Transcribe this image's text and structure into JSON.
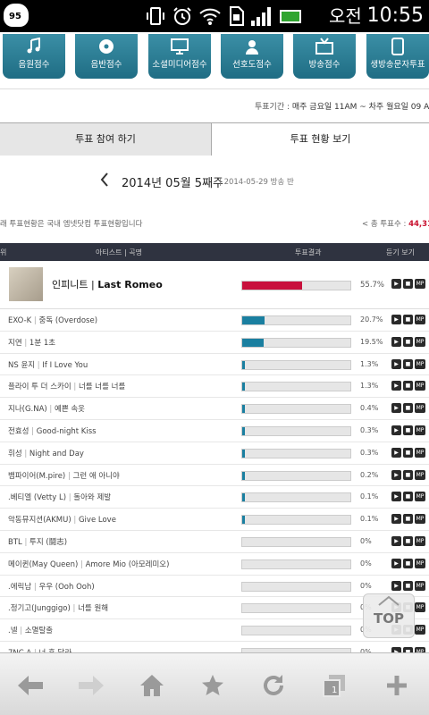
{
  "status_bar": {
    "badge": "95",
    "ampm": "오전",
    "time": "10:55",
    "icons": [
      "vibrate-icon",
      "alarm-icon",
      "wifi-icon",
      "sd-card-icon",
      "signal-icon",
      "battery-icon"
    ]
  },
  "category_tabs": [
    {
      "label": "음원점수",
      "icon": "music-note-icon"
    },
    {
      "label": "음반점수",
      "icon": "disc-icon"
    },
    {
      "label": "소셜미디어점수",
      "icon": "monitor-icon"
    },
    {
      "label": "선호도점수",
      "icon": "person-icon"
    },
    {
      "label": "방송점수",
      "icon": "tv-icon"
    },
    {
      "label": "생방송문자투표",
      "icon": "phone-icon"
    }
  ],
  "period": {
    "label": "투표기간 :",
    "value": "매주 금요일 11AM ~ 차주 월요일 09 A"
  },
  "vote_tabs": {
    "participate": "투표 참여 하기",
    "status": "투표 현황 보기"
  },
  "week": {
    "title": "2014년 05월 5째주",
    "sub": "| 2014-05-29 방송 반"
  },
  "note": "래 투표현황은 국내 엠넷닷컴 투표현황입니다",
  "total": {
    "label": "< 총 투표수 :",
    "value": "44,31"
  },
  "table_header": {
    "col0": "위",
    "artist": "아티스트",
    "song": "곡명",
    "result": "투표결과",
    "listen": "듣기 보기"
  },
  "rows": [
    {
      "artist": "인피니트",
      "song": "Last Romeo",
      "percent_value": 55.7,
      "pct_text": "55.7%"
    },
    {
      "artist": "EXO-K",
      "song": "중독 (Overdose)",
      "percent_value": 20.7,
      "pct_text": "20.7%"
    },
    {
      "artist": "지연",
      "song": "1분 1초",
      "percent_value": 19.5,
      "pct_text": "19.5%"
    },
    {
      "artist": "NS 윤지",
      "song": "If I Love You",
      "percent_value": 1.3,
      "pct_text": "1.3%"
    },
    {
      "artist": "플라이 투 더 스카이",
      "song": "너를 너를 너를",
      "percent_value": 1.3,
      "pct_text": "1.3%"
    },
    {
      "artist": "지나(G.NA)",
      "song": "예쁜 속옷",
      "percent_value": 0.4,
      "pct_text": "0.4%"
    },
    {
      "artist": "전효성",
      "song": "Good-night Kiss",
      "percent_value": 0.3,
      "pct_text": "0.3%"
    },
    {
      "artist": "휘성",
      "song": "Night and Day",
      "percent_value": 0.3,
      "pct_text": "0.3%"
    },
    {
      "artist": "뱀파이어(M.pire)",
      "song": "그런 애 아니야",
      "percent_value": 0.2,
      "pct_text": "0.2%"
    },
    {
      "artist": "베티엘 (Vetty L)",
      "song": "돌아와 제발",
      "percent_value": 0.1,
      "pct_text": "0.1%"
    },
    {
      "artist": "악동뮤지션(AKMU)",
      "song": "Give Love",
      "percent_value": 0.1,
      "pct_text": "0.1%"
    },
    {
      "artist": "BTL",
      "song": "투지 (鬪志)",
      "percent_value": 0,
      "pct_text": "0%"
    },
    {
      "artist": "메이퀸(May Queen)",
      "song": "Amore Mio (아모레미오)",
      "percent_value": 0,
      "pct_text": "0%"
    },
    {
      "artist": "에릭남",
      "song": "우우 (Ooh Ooh)",
      "percent_value": 0,
      "pct_text": "0%"
    },
    {
      "artist": "정기고(Junggigo)",
      "song": "너를 원해",
      "percent_value": 0,
      "pct_text": "0%"
    },
    {
      "artist": "넬",
      "song": "소멸탈출",
      "percent_value": 0,
      "pct_text": "0%"
    },
    {
      "artist": "NC.A",
      "song": "너 혼 달라",
      "percent_value": 0,
      "pct_text": "0%"
    }
  ],
  "rank_prefixes": [
    "",
    "",
    "",
    "",
    "",
    "",
    "",
    "",
    "",
    ".",
    "",
    "",
    "",
    ".",
    ".",
    ".",
    "7"
  ],
  "row_buttons": {
    "play": "▶",
    "video": "■",
    "mp3": "MP"
  },
  "top_button": "TOP",
  "accent": {
    "top_bar": "#c8103c",
    "bar": "#1a7fa0",
    "header": "#2f3340",
    "tab": "#2a7f97"
  },
  "browser_nav": [
    "back-icon",
    "forward-icon",
    "home-icon",
    "bookmark-star-icon",
    "refresh-icon",
    "tabs-icon",
    "new-tab-plus-icon"
  ]
}
